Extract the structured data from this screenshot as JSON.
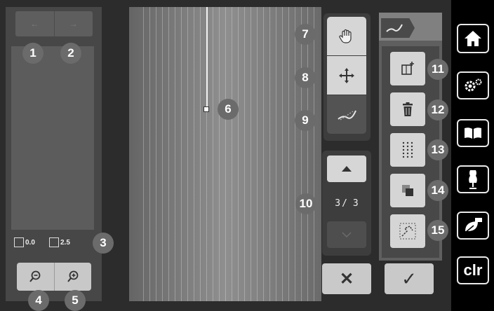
{
  "left_panel": {
    "prev_arrow": "←",
    "next_arrow": "→",
    "info_left_value": "0.0",
    "info_right_value": "2.5"
  },
  "page": {
    "current": "3",
    "separator": "/",
    "total": "3"
  },
  "callouts": [
    "1",
    "2",
    "3",
    "4",
    "5",
    "6",
    "7",
    "8",
    "9",
    "10",
    "11",
    "12",
    "13",
    "14",
    "15"
  ],
  "sidebar": {
    "clr_label": "clr"
  },
  "icons": {
    "zoom_out": "zoom-out-icon",
    "zoom_in": "zoom-in-icon",
    "hand": "hand-icon",
    "move": "move-arrows-icon",
    "stitch": "stitch-edit-icon",
    "up": "up-arrow-icon",
    "down": "down-arrow-icon",
    "cancel": "close-icon",
    "confirm": "checkmark-icon"
  },
  "colors": {
    "accent_badge": "#6b6b6b",
    "button_light": "#d5d5d5",
    "sidebar_bg": "#000000"
  }
}
